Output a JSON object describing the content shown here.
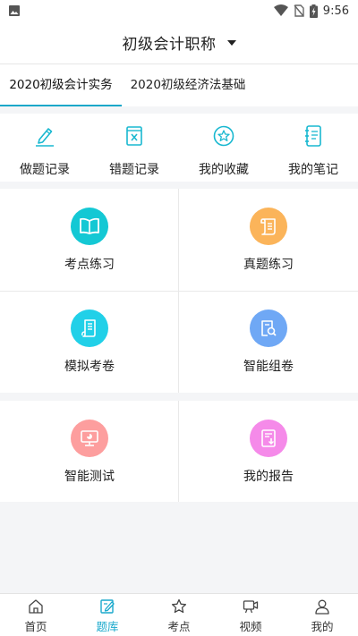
{
  "status_bar": {
    "time": "9:56"
  },
  "header": {
    "title": "初级会计职称"
  },
  "tabs": [
    {
      "label": "2020初级会计实务",
      "active": true
    },
    {
      "label": "2020初级经济法基础",
      "active": false
    }
  ],
  "quick_actions": [
    {
      "label": "做题记录",
      "icon": "pencil-icon"
    },
    {
      "label": "错题记录",
      "icon": "wrong-book-icon"
    },
    {
      "label": "我的收藏",
      "icon": "star-badge-icon"
    },
    {
      "label": "我的笔记",
      "icon": "notebook-icon"
    }
  ],
  "practice": [
    {
      "label": "考点练习",
      "icon": "book-icon",
      "color": "#14c8d4"
    },
    {
      "label": "真题练习",
      "icon": "scroll-icon",
      "color": "#fbb45a"
    },
    {
      "label": "模拟考卷",
      "icon": "paper-icon",
      "color": "#21d0e8"
    },
    {
      "label": "智能组卷",
      "icon": "search-paper-icon",
      "color": "#6fa8f5"
    }
  ],
  "tests": [
    {
      "label": "智能测试",
      "icon": "monitor-icon",
      "color": "#fd9e9e"
    },
    {
      "label": "我的报告",
      "icon": "report-icon",
      "color": "#f58ae9"
    }
  ],
  "bottom_nav": [
    {
      "label": "首页",
      "icon": "home-icon",
      "active": false
    },
    {
      "label": "题库",
      "icon": "edit-icon",
      "active": true
    },
    {
      "label": "考点",
      "icon": "star-icon",
      "active": false
    },
    {
      "label": "视频",
      "icon": "video-icon",
      "active": false
    },
    {
      "label": "我的",
      "icon": "user-icon",
      "active": false
    }
  ],
  "colors": {
    "accent": "#19a9cc",
    "divider": "#e9e9e9",
    "background": "#f4f5f7"
  }
}
